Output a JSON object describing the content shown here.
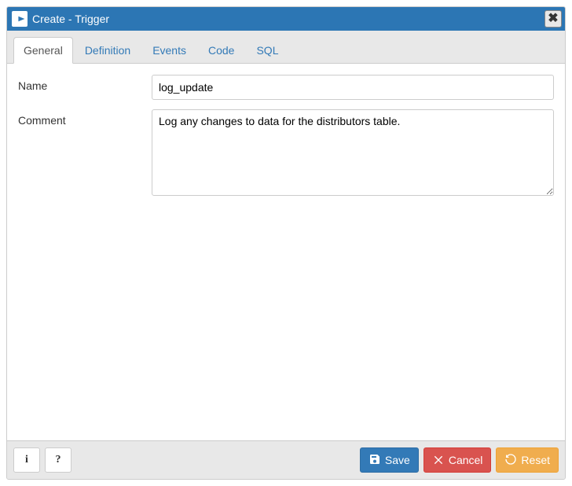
{
  "dialog": {
    "title": "Create - Trigger"
  },
  "tabs": [
    {
      "label": "General"
    },
    {
      "label": "Definition"
    },
    {
      "label": "Events"
    },
    {
      "label": "Code"
    },
    {
      "label": "SQL"
    }
  ],
  "form": {
    "name_label": "Name",
    "name_value": "log_update",
    "comment_label": "Comment",
    "comment_value": "Log any changes to data for the distributors table."
  },
  "footer": {
    "info_label": "i",
    "help_label": "?",
    "save_label": "Save",
    "cancel_label": "Cancel",
    "reset_label": "Reset"
  }
}
